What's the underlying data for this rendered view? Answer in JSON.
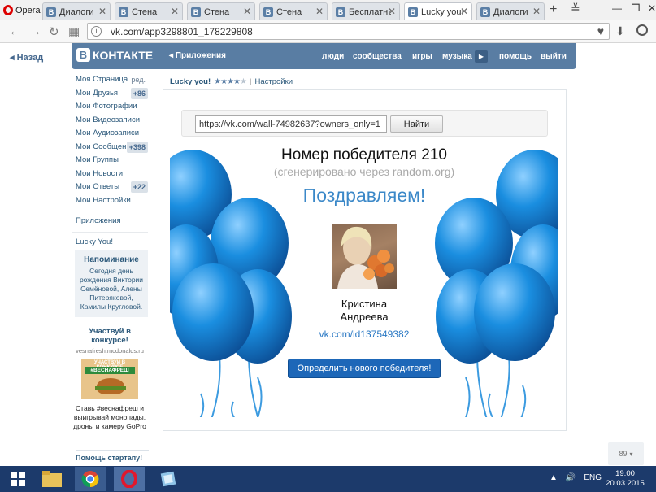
{
  "browser": {
    "menu_label": "Opera",
    "tabs": [
      {
        "label": "Диалоги",
        "favicon": "B"
      },
      {
        "label": "Стена",
        "favicon": "B"
      },
      {
        "label": "Стена",
        "favicon": "B"
      },
      {
        "label": "Стена",
        "favicon": "B"
      },
      {
        "label": "Бесплатны",
        "favicon": "B"
      },
      {
        "label": "Lucky you!",
        "favicon": "B"
      },
      {
        "label": "Диалоги",
        "favicon": "B"
      }
    ],
    "url": "vk.com/app3298801_178229808"
  },
  "vk": {
    "back_label": "Назад",
    "logo_box": "В",
    "logo_word": "КОНТАКТЕ",
    "apps_crumb": "Приложения",
    "nav": [
      "люди",
      "сообщества",
      "игры",
      "музыка",
      "помощь",
      "выйти"
    ],
    "left_menu": [
      {
        "label": "Моя Страница",
        "badge": "ред."
      },
      {
        "label": "Мои Друзья",
        "badge": "+86"
      },
      {
        "label": "Мои Фотографии",
        "badge": ""
      },
      {
        "label": "Мои Видеозаписи",
        "badge": ""
      },
      {
        "label": "Мои Аудиозаписи",
        "badge": ""
      },
      {
        "label": "Мои Сообщения",
        "badge": "+398"
      },
      {
        "label": "Мои Группы",
        "badge": ""
      },
      {
        "label": "Мои Новости",
        "badge": ""
      },
      {
        "label": "Мои Ответы",
        "badge": "+22"
      },
      {
        "label": "Мои Настройки",
        "badge": ""
      }
    ],
    "apps_link": "Приложения",
    "lucky_link": "Lucky You!",
    "reminder": {
      "title": "Напоминание",
      "body": "Сегодня день рождения Виктории Семёновой, Алены Питеряковой, Камилы Кругловой."
    },
    "ad": {
      "title": "Участвуй в конкурсе!",
      "domain": "vesnafresh.mcdonalds.ru",
      "img_top": "УЧАСТВУЙ В КОНКУРСЕ",
      "img_tag": "#ВЕСНАФРЕШ",
      "text": "Ставь #веснафреш и выигрывай монопады, дроны и камеру GoPro"
    },
    "help_start": "Помощь стартапу!",
    "scroll_counter": "89"
  },
  "app": {
    "name": "Lucky you!",
    "stars": "★★★★★",
    "rating": 4,
    "rating_max": 5,
    "settings_label": "Настройки",
    "search_value": "https://vk.com/wall-74982637?owners_only=1",
    "find_label": "Найти",
    "winner_title": "Номер победителя 210",
    "winner_sub": "(сгенерировано через random.org)",
    "congrats": "Поздравляем!",
    "winner_first": "Кристина",
    "winner_last": "Андреева",
    "winner_link": "vk.com/id137549382",
    "new_winner_label": "Определить нового победителя!"
  },
  "taskbar": {
    "lang": "ENG",
    "time": "19:00",
    "date": "20.03.2015"
  },
  "colors": {
    "vk_header": "#597da3",
    "link": "#2b587a",
    "balloon": "#1a8ee0",
    "button": "#1d67b8"
  }
}
